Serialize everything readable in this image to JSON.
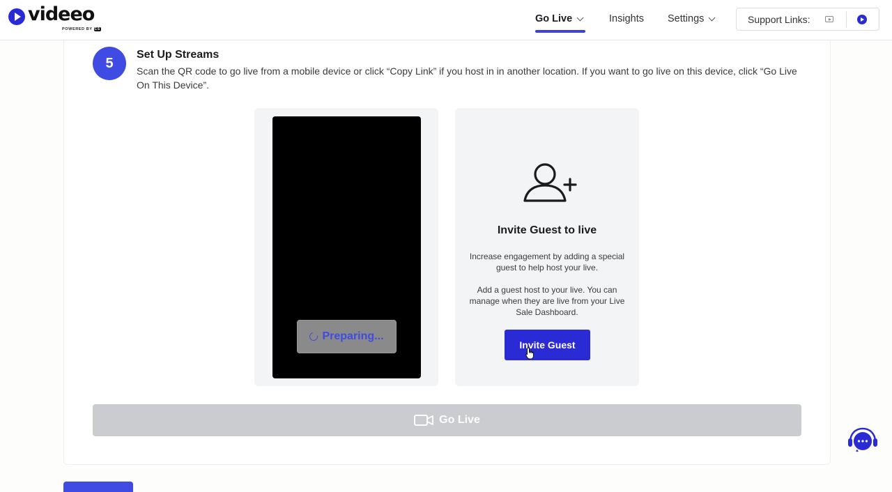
{
  "brand": {
    "name": "videeo",
    "powered_by": "POWERED BY",
    "powered_mark": "CS"
  },
  "nav": {
    "go_live": "Go Live",
    "insights": "Insights",
    "settings": "Settings",
    "support_label": "Support Links:"
  },
  "step": {
    "number": "5",
    "title": "Set Up Streams",
    "description": "Scan the QR code to go live from a mobile device or click “Copy Link” if you host in in another location. If you want to go live on this device, click “Go Live On This Device”."
  },
  "preview": {
    "status_label": "Preparing..."
  },
  "guest": {
    "title": "Invite Guest to live",
    "text1": "Increase engagement by adding a special guest to help host your live.",
    "text2": "Add a guest host to your live. You can manage when they are live from your Live Sale Dashboard.",
    "button_label": "Invite Guest"
  },
  "go_live_button": {
    "label": "Go Live"
  },
  "colors": {
    "accent": "#2b2bd6",
    "step": "#3f4be3",
    "disabled": "#cbcccf"
  },
  "icons": [
    "play-logo-icon",
    "chevron-down-icon",
    "youtube-icon",
    "videeo-icon",
    "spinner-icon",
    "user-plus-icon",
    "camera-icon",
    "chat-support-icon"
  ]
}
